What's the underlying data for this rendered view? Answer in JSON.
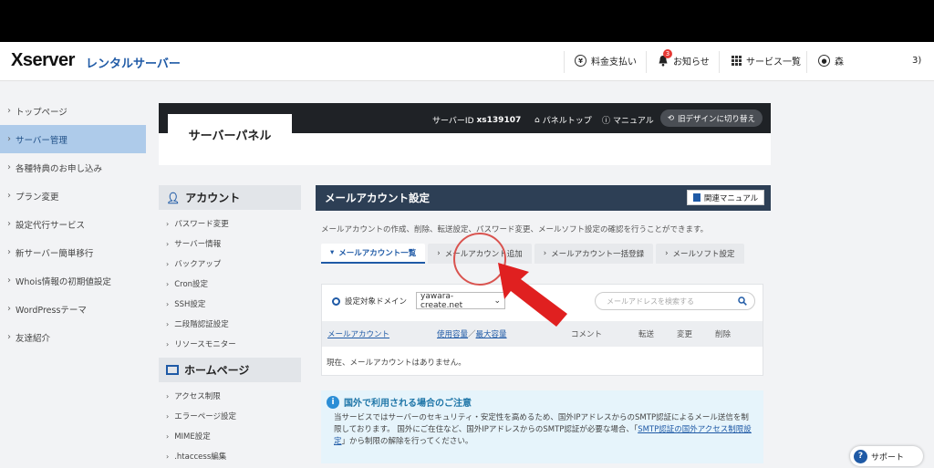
{
  "header": {
    "logo_main": "Xserver",
    "logo_sub": "レンタルサーバー",
    "payment_label": "料金支払い",
    "notifications_label": "お知らせ",
    "notifications_count": "3",
    "services_label": "サービス一覧",
    "user_name": "森",
    "user_suffix": "3)"
  },
  "sidebar": {
    "items": [
      {
        "label": "トップページ"
      },
      {
        "label": "サーバー管理"
      },
      {
        "label": "各種特典のお申し込み"
      },
      {
        "label": "プラン変更"
      },
      {
        "label": "設定代行サービス"
      },
      {
        "label": "新サーバー簡単移行"
      },
      {
        "label": "Whois情報の初期値設定"
      },
      {
        "label": "WordPressテーマ"
      },
      {
        "label": "友達紹介"
      }
    ]
  },
  "panel": {
    "title": "サーバーパネル",
    "server_id_label": "サーバーID",
    "server_id": "xs139107",
    "panel_top": "パネルトップ",
    "manual": "マニュアル",
    "old_design": "旧デザインに切り替え"
  },
  "panel_nav": {
    "account_title": "アカウント",
    "account_items": [
      {
        "label": "パスワード変更"
      },
      {
        "label": "サーバー情報"
      },
      {
        "label": "バックアップ"
      },
      {
        "label": "Cron設定"
      },
      {
        "label": "SSH設定"
      },
      {
        "label": "二段階認証設定"
      },
      {
        "label": "リソースモニター"
      }
    ],
    "homepage_title": "ホームページ",
    "homepage_items": [
      {
        "label": "アクセス制限"
      },
      {
        "label": "エラーページ設定"
      },
      {
        "label": "MIME設定"
      },
      {
        "label": ".htaccess編集"
      }
    ]
  },
  "content": {
    "title": "メールアカウント設定",
    "manual_button": "関連マニュアル",
    "description": "メールアカウントの作成、削除、転送設定、パスワード変更、メールソフト設定の確認を行うことができます。",
    "tabs": [
      {
        "label": "メールアカウント一覧"
      },
      {
        "label": "メールアカウント追加"
      },
      {
        "label": "メールアカウント一括登録"
      },
      {
        "label": "メールソフト設定"
      }
    ],
    "domain_label": "設定対象ドメイン",
    "domain_value": "yawara-create.net",
    "search_placeholder": "メールアドレスを検索する",
    "table_headers": {
      "account": "メールアカウント",
      "usage": "使用容量",
      "slash": "／",
      "max": "最大容量",
      "comment": "コメント",
      "forward": "転送",
      "edit": "変更",
      "delete": "削除"
    },
    "empty_text": "現在、メールアカウントはありません。"
  },
  "notice": {
    "title": "国外で利用される場合のご注意",
    "text_before": "当サービスではサーバーのセキュリティ・安定性を高めるため、国外IPアドレスからのSMTP認証によるメール送信を制限しております。 国外にご在住など、国外IPアドレスからのSMTP認証が必要な場合、「",
    "link": "SMTP認証の国外アクセス制限設定",
    "text_after": "」から制限の解除を行ってください。"
  },
  "support": {
    "label": "サポート"
  },
  "colors": {
    "accent": "#1f5aa6",
    "sidebar_active": "#aecbea",
    "annotation_red": "#e02020"
  }
}
